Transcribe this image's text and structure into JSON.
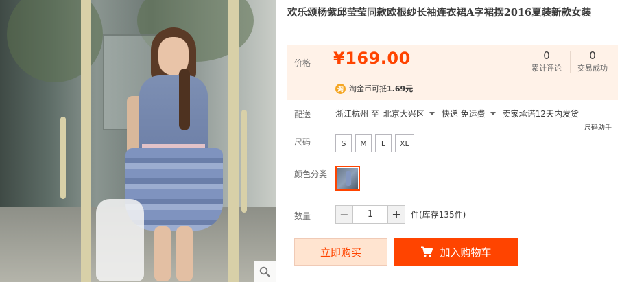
{
  "product": {
    "title": "欢乐颂杨紫邱莹莹同款欧根纱长袖连衣裙A字裙摆2016夏装新款女装"
  },
  "price": {
    "label": "价格",
    "value": "¥169.00",
    "coin_icon_text": "淘",
    "coin_text": "淘金币可抵",
    "coin_amount": "1.69元"
  },
  "stats": [
    {
      "number": "0",
      "label": "累计评论"
    },
    {
      "number": "0",
      "label": "交易成功"
    }
  ],
  "shipping": {
    "label": "配送",
    "from": "浙江杭州 至",
    "to": "北京大兴区",
    "method": "快递 免运费",
    "promise": "卖家承诺12天内发货",
    "size_helper": "尺码助手"
  },
  "size": {
    "label": "尺码",
    "options": [
      "S",
      "M",
      "L",
      "XL"
    ]
  },
  "color": {
    "label": "颜色分类"
  },
  "quantity": {
    "label": "数量",
    "minus": "−",
    "value": "1",
    "plus": "+",
    "stock_text": "件(库存135件)"
  },
  "actions": {
    "buy_now": "立即购买",
    "add_to_cart": "加入购物车"
  },
  "colors": {
    "accent": "#ff4400",
    "price_bg": "#fff2e8"
  }
}
